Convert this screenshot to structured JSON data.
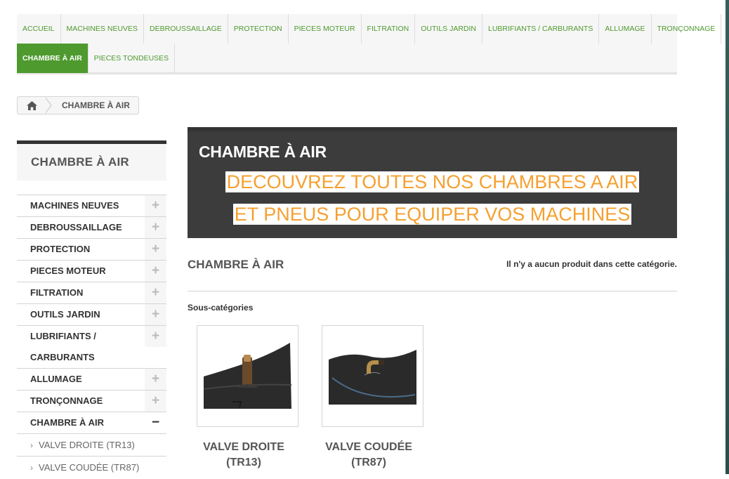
{
  "top_menu": {
    "items": [
      {
        "label": "ACCUEIL"
      },
      {
        "label": "MACHINES NEUVES"
      },
      {
        "label": "DEBROUSSAILLAGE"
      },
      {
        "label": "PROTECTION"
      },
      {
        "label": "PIECES MOTEUR"
      },
      {
        "label": "FILTRATION"
      },
      {
        "label": "OUTILS JARDIN"
      },
      {
        "label": "LUBRIFIANTS / CARBURANTS"
      },
      {
        "label": "ALLUMAGE"
      },
      {
        "label": "TRONÇONNAGE"
      },
      {
        "label": "CHAMBRE À AIR",
        "active": true
      },
      {
        "label": "PIECES TONDEUSES"
      }
    ]
  },
  "breadcrumb": {
    "home_icon": "home-icon",
    "current": "CHAMBRE À AIR"
  },
  "sidebar": {
    "title": "CHAMBRE À AIR",
    "items": [
      {
        "label": "MACHINES NEUVES",
        "toggle": "+"
      },
      {
        "label": "DEBROUSSAILLAGE",
        "toggle": "+"
      },
      {
        "label": "PROTECTION",
        "toggle": "+"
      },
      {
        "label": "PIECES MOTEUR",
        "toggle": "+"
      },
      {
        "label": "FILTRATION",
        "toggle": "+"
      },
      {
        "label": "OUTILS JARDIN",
        "toggle": "+"
      },
      {
        "label": "LUBRIFIANTS / CARBURANTS",
        "toggle": "+"
      },
      {
        "label": "ALLUMAGE",
        "toggle": "+"
      },
      {
        "label": "TRONÇONNAGE",
        "toggle": "+"
      },
      {
        "label": "CHAMBRE À AIR",
        "toggle": "−"
      }
    ],
    "subitems": [
      {
        "label": "VALVE DROITE (TR13)"
      },
      {
        "label": "VALVE COUDÉE (TR87)"
      }
    ]
  },
  "banner": {
    "title": "CHAMBRE À AIR",
    "promo_line1": "DECOUVREZ TOUTES NOS CHAMBRES A AIR",
    "promo_line2": "ET PNEUS POUR EQUIPER VOS MACHINES",
    "promo_color": "#f5a030"
  },
  "category": {
    "name": "CHAMBRE À AIR",
    "product_count_text": "Il n'y a aucun produit dans cette catégorie."
  },
  "subcategories": {
    "title": "Sous-catégories",
    "items": [
      {
        "name": "VALVE DROITE (TR13)"
      },
      {
        "name": "VALVE COUDÉE (TR87)"
      }
    ]
  },
  "colors": {
    "accent": "#4e9a2e",
    "dark": "#333333"
  }
}
